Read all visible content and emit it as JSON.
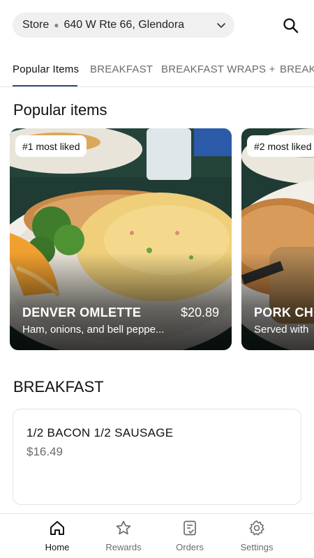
{
  "header": {
    "store_label": "Store",
    "store_address": "640 W Rte 66, Glendora",
    "search_icon": "search-icon",
    "chevron_icon": "chevron-down-icon"
  },
  "tabs": [
    {
      "label": "Popular Items",
      "active": true
    },
    {
      "label": "BREAKFAST",
      "active": false
    },
    {
      "label": "BREAKFAST WRAPS +",
      "active": false
    },
    {
      "label": "BREAKFAST",
      "active": false
    }
  ],
  "popular": {
    "title": "Popular items",
    "cards": [
      {
        "badge": "#1 most liked",
        "name": "DENVER OMLETTE",
        "price": "$20.89",
        "description": "Ham, onions, and bell peppe..."
      },
      {
        "badge": "#2 most liked",
        "name": "PORK CHOPS",
        "price": "",
        "description": "Served with"
      }
    ]
  },
  "breakfast": {
    "title": "BREAKFAST",
    "items": [
      {
        "name": "1/2 BACON 1/2 SAUSAGE",
        "price": "$16.49"
      }
    ]
  },
  "nav": [
    {
      "label": "Home",
      "icon": "home-icon",
      "active": true
    },
    {
      "label": "Rewards",
      "icon": "star-icon",
      "active": false
    },
    {
      "label": "Orders",
      "icon": "orders-icon",
      "active": false
    },
    {
      "label": "Settings",
      "icon": "gear-icon",
      "active": false
    }
  ],
  "colors": {
    "accent": "#2f4a8a",
    "muted": "#6b6b6b"
  }
}
